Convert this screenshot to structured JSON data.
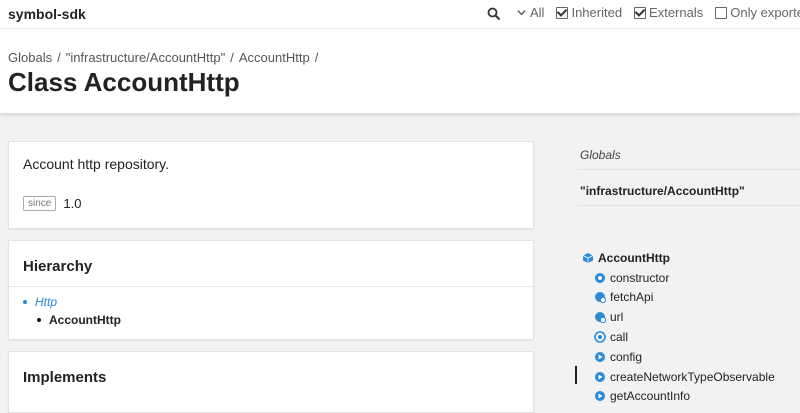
{
  "app": {
    "name": "symbol-sdk"
  },
  "toolbar": {
    "filters": [
      {
        "label": "All",
        "type": "dropdown"
      },
      {
        "label": "Inherited",
        "checked": true
      },
      {
        "label": "Externals",
        "checked": true
      },
      {
        "label": "Only exported",
        "checked": false
      }
    ]
  },
  "breadcrumb": [
    "Globals",
    "\"infrastructure/AccountHttp\"",
    "AccountHttp"
  ],
  "page": {
    "title": "Class AccountHttp"
  },
  "description": {
    "text": "Account http repository.",
    "since_label": "since",
    "since_value": "1.0"
  },
  "hierarchy": {
    "heading": "Hierarchy",
    "parent": "Http",
    "current": "AccountHttp"
  },
  "implements": {
    "heading": "Implements"
  },
  "sidebar": {
    "globals": "Globals",
    "module": "\"infrastructure/AccountHttp\"",
    "class_name": "AccountHttp",
    "members": [
      {
        "name": "constructor",
        "icon": "constructor-icon"
      },
      {
        "name": "fetchApi",
        "icon": "property-icon"
      },
      {
        "name": "url",
        "icon": "property-icon"
      },
      {
        "name": "call",
        "icon": "method-icon"
      },
      {
        "name": "config",
        "icon": "method-icon"
      },
      {
        "name": "createNetworkTypeObservable",
        "icon": "method-icon"
      },
      {
        "name": "getAccountInfo",
        "icon": "method-icon"
      }
    ]
  },
  "colors": {
    "link": "#2b8bd7",
    "icon": "#2b8bd7"
  }
}
